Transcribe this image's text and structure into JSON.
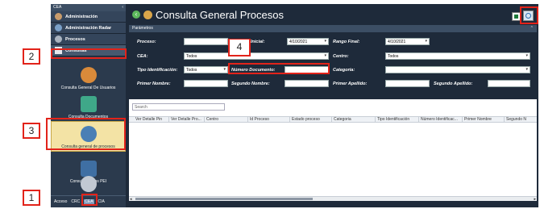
{
  "sidebar": {
    "title": "CEA",
    "collapse": "‹",
    "menu": [
      {
        "label": "Administración"
      },
      {
        "label": "Administración Radar"
      },
      {
        "label": "Procesos"
      },
      {
        "label": "Consultas"
      }
    ],
    "tiles": [
      {
        "label": "Consulta General De Usuarios"
      },
      {
        "label": "Consulta Documentos"
      },
      {
        "label": "Consulta general de procesos"
      },
      {
        "label": "Consulta cursos PEI"
      }
    ],
    "tabs": [
      "Acceso",
      "CRC",
      "CEA",
      "CIA"
    ]
  },
  "header": {
    "title": "Consulta General Procesos"
  },
  "params": {
    "section_label": "Parámetros",
    "proceso_label": "Proceso:",
    "rango_inicial_label": "Inicial:",
    "rango_inicial_value": "4/10/2021",
    "rango_final_label": "Rango Final:",
    "rango_final_value": "4/10/2021",
    "cea_label": "CEA:",
    "cea_value": "Todos",
    "centro_label": "Centro:",
    "centro_value": "Todos",
    "tipo_id_label": "Tipo Identificación:",
    "tipo_id_value": "Todos",
    "numero_doc_label": "Número Documento:",
    "categoria_label": "Categoría:",
    "primer_nombre_label": "Primer Nombre:",
    "segundo_nombre_label": "Segundo Nombre:",
    "primer_apellido_label": "Primer Apellido:",
    "segundo_apellido_label": "Segundo Apellido:"
  },
  "grid": {
    "search_placeholder": "Search",
    "columns": [
      "Ver Detalle Pin",
      "Ver Detalle Pro...",
      "Centro",
      "Id Proceso",
      "Estado proceso",
      "Categoria",
      "Tipo Identificación",
      "Número Identificac...",
      "Primer Nombre",
      "Segundo N"
    ]
  },
  "annotations": [
    "1",
    "2",
    "3",
    "4"
  ],
  "colors": {
    "annotation": "#e2231a",
    "app_bg": "#1e2a3a",
    "selected_tile": "#f3e3a5"
  }
}
